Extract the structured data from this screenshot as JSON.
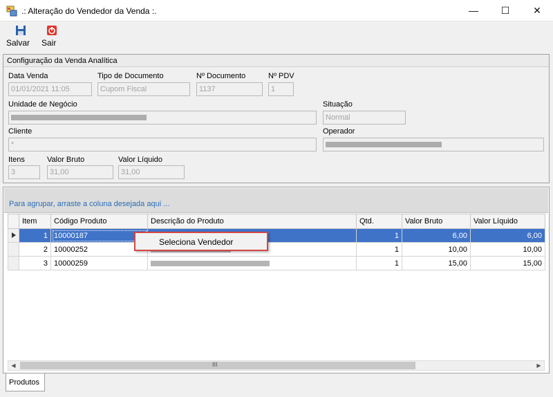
{
  "window": {
    "title": ".: Alteração do Vendedor da Venda :."
  },
  "toolbar": {
    "save_label": "Salvar",
    "exit_label": "Sair"
  },
  "group": {
    "title": "Configuração da Venda Analítica",
    "data_venda": {
      "label": "Data Venda",
      "value": "01/01/2021 11:05"
    },
    "tipo_documento": {
      "label": "Tipo de Documento",
      "value": "Cupom Fiscal"
    },
    "numero_documento": {
      "label": "Nº Documento",
      "value": "1137"
    },
    "numero_pdv": {
      "label": "Nº PDV",
      "value": "1"
    },
    "unidade_negocio": {
      "label": "Unidade de Negócio"
    },
    "situacao": {
      "label": "Situação",
      "value": "Normal"
    },
    "cliente": {
      "label": "Cliente",
      "value": "*"
    },
    "operador": {
      "label": "Operador"
    },
    "itens": {
      "label": "Itens",
      "value": "3"
    },
    "valor_bruto": {
      "label": "Valor Bruto",
      "value": "31,00"
    },
    "valor_liquido": {
      "label": "Valor Líquido",
      "value": "31,00"
    }
  },
  "grid": {
    "group_hint": "Para agrupar, arraste a coluna desejada aqui ...",
    "columns": [
      "Item",
      "Código Produto",
      "Descrição do Produto",
      "Qtd.",
      "Valor Bruto",
      "Valor Líquido"
    ],
    "rows": [
      {
        "item": "1",
        "codigo": "10000187",
        "qtd": "1",
        "bruto": "6,00",
        "liquido": "6,00"
      },
      {
        "item": "2",
        "codigo": "10000252",
        "qtd": "1",
        "bruto": "10,00",
        "liquido": "10,00"
      },
      {
        "item": "3",
        "codigo": "10000259",
        "qtd": "1",
        "bruto": "15,00",
        "liquido": "15,00"
      }
    ],
    "scroll_grip": "III"
  },
  "context_menu": {
    "item_label": "Seleciona Vendedor"
  },
  "tabs": [
    {
      "label": "Produtos"
    }
  ],
  "colors": {
    "selection": "#3f73c8",
    "link_hint": "#2a6cb5",
    "menu_border": "#d64545"
  }
}
